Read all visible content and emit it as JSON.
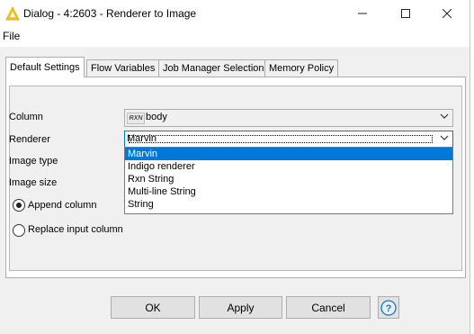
{
  "window": {
    "title": "Dialog - 4:2603 - Renderer to Image",
    "minimize_glyph": "—",
    "maximize_glyph": "☐",
    "close_glyph": "✕",
    "icon": "knime-triangle-icon"
  },
  "menu": {
    "file": "File"
  },
  "tabs": [
    {
      "label": "Default Settings",
      "active": true
    },
    {
      "label": "Flow Variables"
    },
    {
      "label": "Job Manager Selection"
    },
    {
      "label": "Memory Policy"
    }
  ],
  "form": {
    "column_label": "Column",
    "column_value": "body",
    "column_type_badge": "RXN",
    "renderer_label": "Renderer",
    "renderer_value": "Marvin",
    "image_type_label": "Image type",
    "image_size_label": "Image size",
    "append_label": "Append column",
    "replace_label": "Replace input column",
    "selected_output": "append"
  },
  "renderer_options": [
    {
      "label": "Marvin",
      "selected": true
    },
    {
      "label": "Indigo renderer"
    },
    {
      "label": "Rxn String"
    },
    {
      "label": "Multi-line String"
    },
    {
      "label": "String"
    }
  ],
  "buttons": {
    "ok": "OK",
    "apply": "Apply",
    "cancel": "Cancel",
    "help_glyph": "?"
  },
  "colors": {
    "selection": "#0078d7",
    "help_icon": "#1a73c8"
  }
}
